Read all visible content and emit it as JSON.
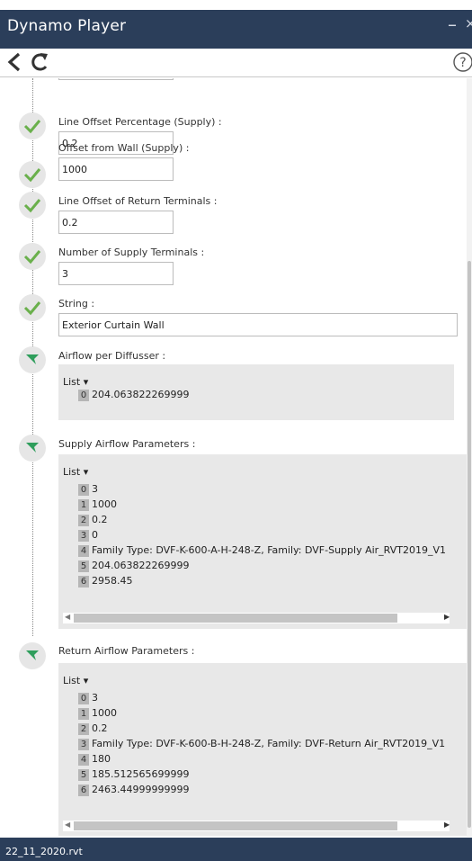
{
  "window": {
    "title": "Dynamo Player",
    "minimize": "–",
    "close": "×"
  },
  "status": {
    "file": "22_11_2020.rvt"
  },
  "inputs": [
    {
      "label": "Line Offset Percentage (Supply) :",
      "value": "0.2"
    },
    {
      "label": "Offset from Wall (Supply) :",
      "value": "1000"
    },
    {
      "label": "Line Offset of Return Terminals :",
      "value": "0.2"
    },
    {
      "label": "Number of Supply Terminals :",
      "value": "3"
    },
    {
      "label": "String :",
      "value": "Exterior Curtain Wall"
    }
  ],
  "outputs": [
    {
      "label": "Airflow per Diffusser :",
      "list_label": "List ▾",
      "items": [
        {
          "index": "0",
          "value": "204.063822269999"
        }
      ]
    },
    {
      "label": "Supply Airflow Parameters :",
      "list_label": "List ▾",
      "items": [
        {
          "index": "0",
          "value": "3"
        },
        {
          "index": "1",
          "value": "1000"
        },
        {
          "index": "2",
          "value": "0.2"
        },
        {
          "index": "3",
          "value": "0"
        },
        {
          "index": "4",
          "value": "Family Type: DVF-K-600-A-H-248-Z, Family: DVF-Supply Air_RVT2019_V1"
        },
        {
          "index": "5",
          "value": "204.063822269999"
        },
        {
          "index": "6",
          "value": "2958.45"
        }
      ]
    },
    {
      "label": "Return Airflow Parameters :",
      "list_label": "List ▾",
      "items": [
        {
          "index": "0",
          "value": "3"
        },
        {
          "index": "1",
          "value": "1000"
        },
        {
          "index": "2",
          "value": "0.2"
        },
        {
          "index": "3",
          "value": "Family Type: DVF-K-600-B-H-248-Z, Family: DVF-Return Air_RVT2019_V1"
        },
        {
          "index": "4",
          "value": "180"
        },
        {
          "index": "5",
          "value": "185.512565699999"
        },
        {
          "index": "6",
          "value": "2463.44999999999"
        }
      ]
    }
  ],
  "colors": {
    "titlebar": "#2b3e5a",
    "check": "#6ab04c",
    "flag": "#2f9e5c"
  }
}
